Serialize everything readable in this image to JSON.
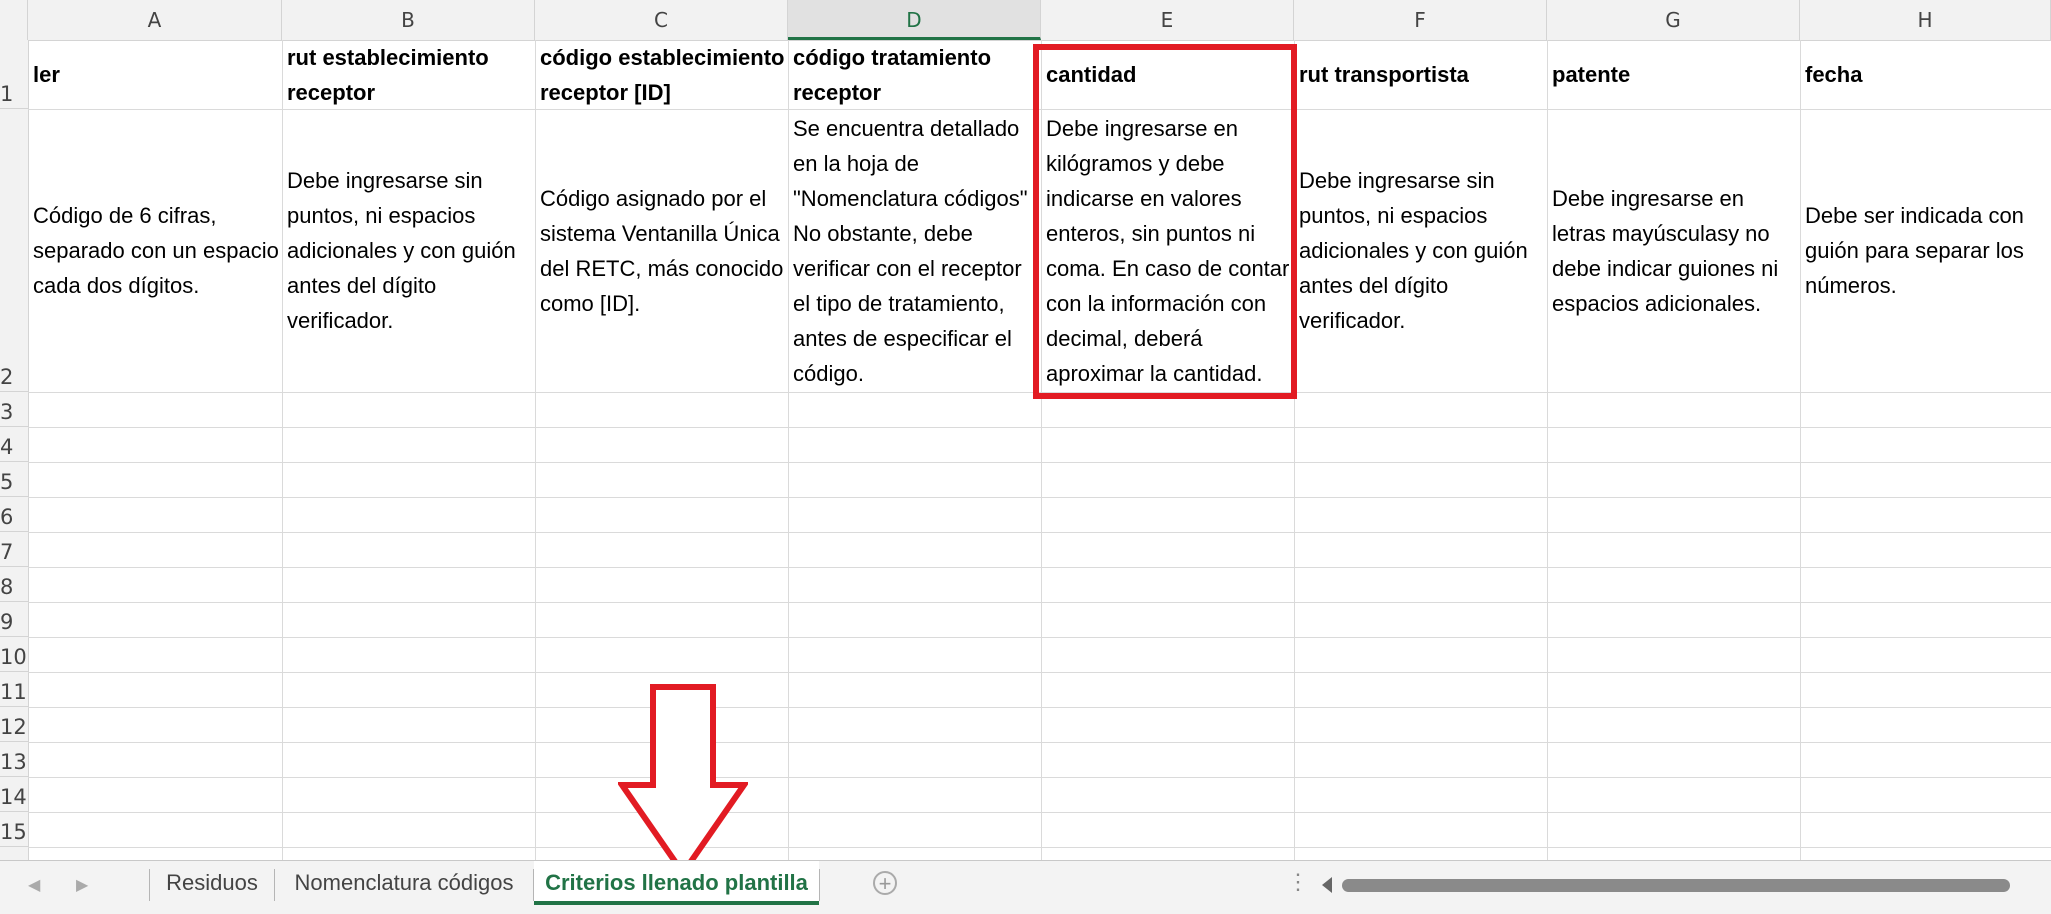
{
  "columns": [
    "A",
    "B",
    "C",
    "D",
    "E",
    "F",
    "G",
    "H"
  ],
  "selected_column": "D",
  "rows": [
    "1",
    "2",
    "3",
    "4",
    "5",
    "6",
    "7",
    "8",
    "9",
    "10",
    "11",
    "12",
    "13",
    "14",
    "15"
  ],
  "header_row": {
    "A": "ler",
    "B": "rut establecimiento receptor",
    "C": "código establecimiento receptor [ID]",
    "D": "código tratamiento receptor",
    "E": "cantidad",
    "F": "rut transportista",
    "G": "patente",
    "H": "fecha"
  },
  "criteria_row": {
    "A": "Código de 6 cifras, separado con un espacio cada dos dígitos.",
    "B": "Debe ingresarse sin puntos, ni espacios adicionales y con guión antes del dígito verificador.",
    "C": "Código asignado por el sistema Ventanilla Única del RETC, más conocido como [ID].",
    "D": "Se encuentra detallado en la hoja de \"Nomenclatura códigos\" No obstante, debe verificar con el receptor el tipo de tratamiento, antes de especificar el código.",
    "E": "Debe ingresarse en kilógramos y debe indicarse en valores enteros, sin puntos ni coma. En caso de contar con la información con decimal, deberá aproximar la cantidad.",
    "F": "Debe ingresarse sin puntos, ni espacios adicionales y con guión antes del dígito verificador.",
    "G": "Debe ingresarse en letras mayúsculasy no debe indicar guiones ni espacios adicionales.",
    "H": "Debe ser indicada con guión para separar los números."
  },
  "sheet_tabs": [
    "Residuos",
    "Nomenclatura códigos",
    "Criterios llenado plantilla"
  ],
  "active_tab": "Criterios llenado plantilla",
  "colors": {
    "accent": "#217346",
    "highlight": "#e21b23"
  },
  "icons": {
    "prev": "chevron-left-icon",
    "next": "chevron-right-icon",
    "add": "plus-circle-icon",
    "more": "more-vertical-icon"
  }
}
